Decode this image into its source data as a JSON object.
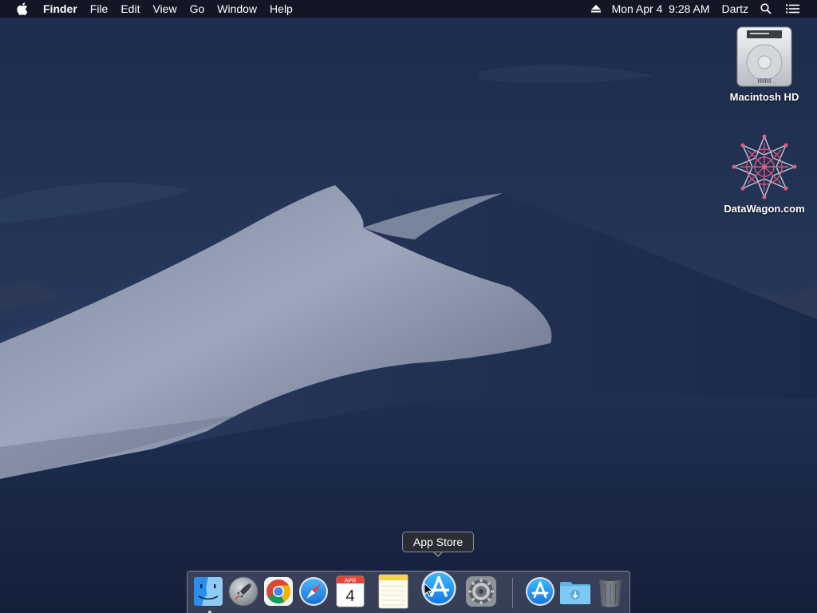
{
  "menubar": {
    "app_name": "Finder",
    "menus": [
      "File",
      "Edit",
      "View",
      "Go",
      "Window",
      "Help"
    ],
    "status": {
      "eject_icon": "eject-icon",
      "datetime": "Mon Apr 4  9:28 AM",
      "user": "Dartz",
      "search_icon": "spotlight-search-icon",
      "notification_icon": "notification-center-icon"
    }
  },
  "desktop": {
    "icons": [
      {
        "label": "Macintosh HD",
        "icon": "hard-drive-icon"
      },
      {
        "label": "DataWagon.com",
        "icon": "datawagon-logo-icon"
      }
    ]
  },
  "tooltip": {
    "text": "App Store"
  },
  "dock": {
    "apps": [
      {
        "name": "Finder",
        "icon": "finder-icon",
        "running": true
      },
      {
        "name": "Launchpad",
        "icon": "launchpad-icon",
        "running": false
      },
      {
        "name": "Google Chrome",
        "icon": "chrome-icon",
        "running": false
      },
      {
        "name": "Safari",
        "icon": "safari-icon",
        "running": false
      },
      {
        "name": "Calendar",
        "icon": "calendar-icon",
        "running": false,
        "month": "APR",
        "day": "4"
      },
      {
        "name": "Notes",
        "icon": "notes-icon",
        "running": false
      },
      {
        "name": "App Store",
        "icon": "app-store-icon",
        "running": false
      },
      {
        "name": "System Preferences",
        "icon": "system-preferences-icon",
        "running": false
      }
    ],
    "others": [
      {
        "name": "Applications",
        "icon": "applications-stack-icon"
      },
      {
        "name": "Downloads",
        "icon": "downloads-folder-icon"
      },
      {
        "name": "Trash",
        "icon": "trash-icon"
      }
    ]
  },
  "colors": {
    "menubar_bg": "#12162200",
    "sky_top": "#223255",
    "sky_bottom": "#0f1b35",
    "dune_light": "#9aa3b8",
    "tooltip_bg": "#2a2d33"
  }
}
